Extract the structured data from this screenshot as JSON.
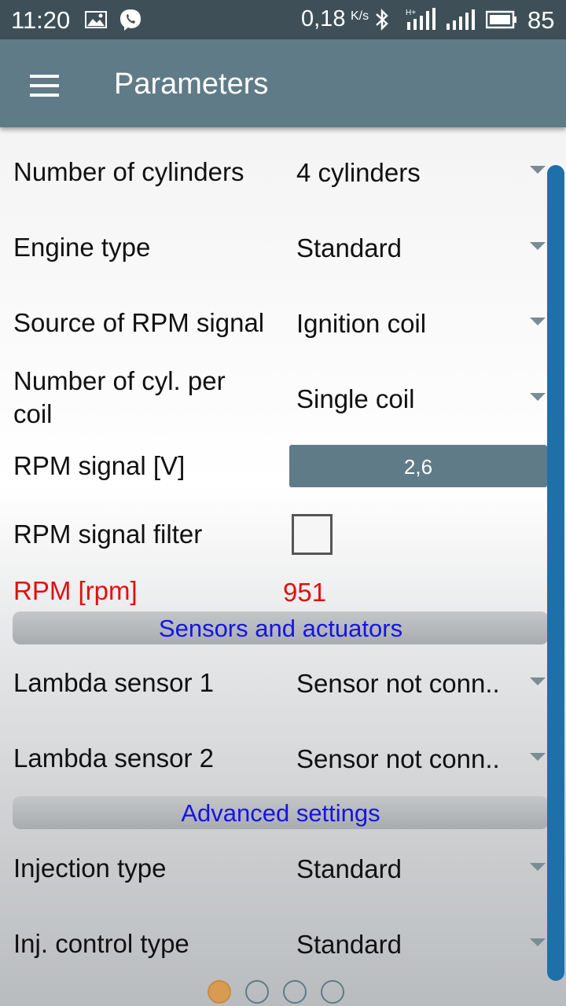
{
  "status_bar": {
    "time": "11:20",
    "network_speed": "0,18",
    "network_unit": "K/s",
    "battery": "85",
    "icons": [
      "image-icon",
      "viber-icon",
      "bluetooth-icon",
      "signal-icon",
      "signal-icon",
      "battery-icon"
    ]
  },
  "app_bar": {
    "title": "Parameters",
    "menu_icon": "hamburger-icon"
  },
  "params": [
    {
      "label": "Number of cylinders",
      "value": "4 cylinders"
    },
    {
      "label": "Engine type",
      "value": "Standard"
    },
    {
      "label": "Source of RPM signal",
      "value": "Ignition coil"
    },
    {
      "label": "Number of cyl. per coil",
      "value": "Single coil"
    }
  ],
  "rpm_signal": {
    "label": "RPM signal [V]",
    "value": "2,6"
  },
  "rpm_filter": {
    "label": "RPM signal filter",
    "checked": false
  },
  "rpm": {
    "label": "RPM [rpm]",
    "value": "951"
  },
  "sections": {
    "sensors": "Sensors and actuators",
    "advanced": "Advanced settings"
  },
  "sensors": [
    {
      "label": "Lambda sensor 1",
      "value": "Sensor not conn.."
    },
    {
      "label": "Lambda sensor 2",
      "value": "Sensor not conn.."
    }
  ],
  "advanced": [
    {
      "label": "Injection type",
      "value": "Standard"
    },
    {
      "label": "Inj. control type",
      "value": "Standard"
    }
  ],
  "pager": {
    "pages": 4,
    "active": 0
  },
  "colors": {
    "app_bar": "#5f7b87",
    "status_bar": "#3e4f57",
    "rpm_text": "#e01010",
    "section_text": "#1414e6",
    "scrollbar": "#1f6fa9",
    "active_dot": "#d99a52"
  }
}
